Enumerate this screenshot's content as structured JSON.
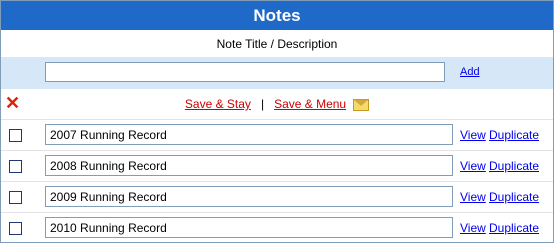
{
  "header": {
    "title": "Notes"
  },
  "column_header": "Note Title / Description",
  "new_note": {
    "value": "",
    "add_label": "Add"
  },
  "actions": {
    "delete_symbol": "✕",
    "save_stay": "Save & Stay",
    "separator": "|",
    "save_menu": "Save & Menu"
  },
  "notes": [
    {
      "title": "2007 Running Record",
      "view": "View",
      "duplicate": "Duplicate"
    },
    {
      "title": "2008 Running Record",
      "view": "View",
      "duplicate": "Duplicate"
    },
    {
      "title": "2009 Running Record",
      "view": "View",
      "duplicate": "Duplicate"
    },
    {
      "title": "2010 Running Record",
      "view": "View",
      "duplicate": "Duplicate"
    }
  ]
}
